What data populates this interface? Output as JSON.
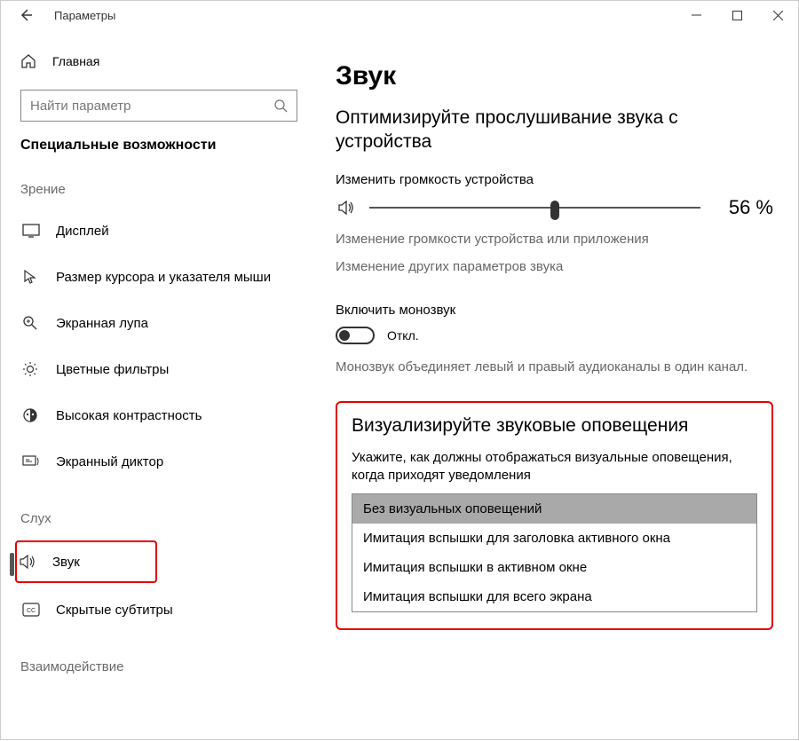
{
  "window": {
    "title": "Параметры"
  },
  "sidebar": {
    "home": "Главная",
    "search_placeholder": "Найти параметр",
    "category": "Специальные возможности",
    "groups": {
      "vision": "Зрение",
      "hearing": "Слух",
      "interaction": "Взаимодействие"
    },
    "items": {
      "display": "Дисплей",
      "cursor": "Размер курсора и указателя мыши",
      "magnifier": "Экранная лупа",
      "color_filters": "Цветные фильтры",
      "high_contrast": "Высокая контрастность",
      "narrator": "Экранный диктор",
      "audio": "Звук",
      "captions": "Скрытые субтитры"
    }
  },
  "main": {
    "title": "Звук",
    "optimize": "Оптимизируйте прослушивание звука с устройства",
    "volume_label": "Изменить громкость устройства",
    "volume_value": "56 %",
    "volume_percent": 56,
    "link_app_volume": "Изменение громкости устройства или приложения",
    "link_other": "Изменение других параметров звука",
    "mono_label": "Включить монозвук",
    "mono_state": "Откл.",
    "mono_desc": "Монозвук объединяет левый и правый аудиоканалы в один канал.",
    "visual": {
      "heading": "Визуализируйте звуковые оповещения",
      "desc": "Укажите, как должны отображаться визуальные оповещения, когда приходят уведомления",
      "options": [
        "Без визуальных оповещений",
        "Имитация вспышки для заголовка активного окна",
        "Имитация вспышки в активном окне",
        "Имитация вспышки для всего экрана"
      ]
    }
  }
}
